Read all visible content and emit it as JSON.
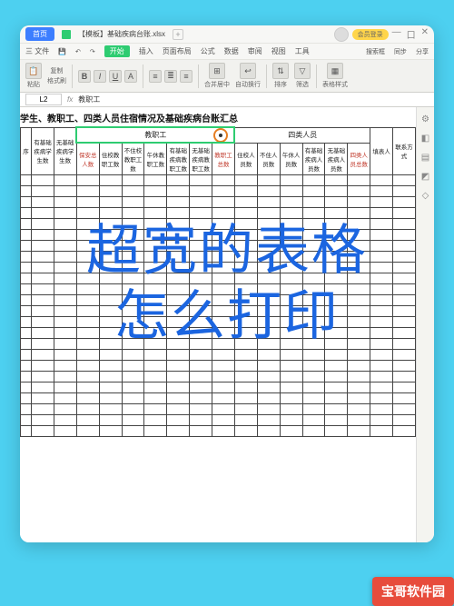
{
  "window": {
    "home": "首页",
    "filename": "【模板】基础疾病台账.xlsx",
    "add": "+",
    "vip": "会员登录"
  },
  "menu": {
    "file": "三 文件",
    "active": "开始",
    "items": [
      "插入",
      "页面布局",
      "公式",
      "数据",
      "审阅",
      "视图",
      "工具"
    ],
    "right": [
      "搜索框",
      "同步",
      "分享"
    ]
  },
  "toolbar": {
    "paste": "粘贴",
    "copy": "复制",
    "format": "格式刷",
    "bold": "B",
    "italic": "I",
    "under": "U",
    "a": "A",
    "merge": "合并居中",
    "wrap": "自动换行",
    "sort": "排序",
    "filter": "筛选",
    "table": "表格样式"
  },
  "formula": {
    "cell": "L2",
    "fx": "fx",
    "value": "教职工"
  },
  "sheet": {
    "title": "学生、教职工、四类人员住宿情况及基础疾病台账汇总",
    "group1": "教职工",
    "group2": "四类人员",
    "headers1": [
      "序",
      "有基础疾病学生数",
      "无基础疾病学生数",
      "保安总人数",
      "住校教职工数",
      "不住校教职工数",
      "午休教职工数",
      "有基础疾病教职工数",
      "无基础疾病教职工数",
      "教职工总数",
      "住校人员数",
      "不住人员数",
      "午休人员数",
      "有基础疾病人员数",
      "无基础疾病人员数",
      "四类人员总数",
      "填表人",
      "联系方式"
    ]
  },
  "overlay": {
    "l1": "超宽的表格",
    "l2": "怎么打印"
  },
  "watermark": "宝哥软件园"
}
